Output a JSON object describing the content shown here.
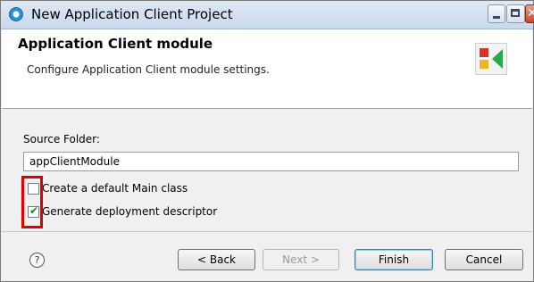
{
  "window": {
    "title": "New Application Client Project"
  },
  "banner": {
    "title": "Application Client module",
    "description": "Configure Application Client module settings."
  },
  "form": {
    "source_folder_label": "Source Folder:",
    "source_folder_value": "appClientModule",
    "create_main_class": {
      "label": "Create a default Main class",
      "checked": false
    },
    "generate_descriptor": {
      "label": "Generate deployment descriptor",
      "checked": true
    }
  },
  "buttons": {
    "back": "< Back",
    "next": "Next >",
    "finish": "Finish",
    "cancel": "Cancel"
  },
  "help": {
    "glyph": "?"
  },
  "colors": {
    "highlight_box": "#e00000",
    "check": "#1b8a1b",
    "finish_border": "#3c7fb1"
  }
}
